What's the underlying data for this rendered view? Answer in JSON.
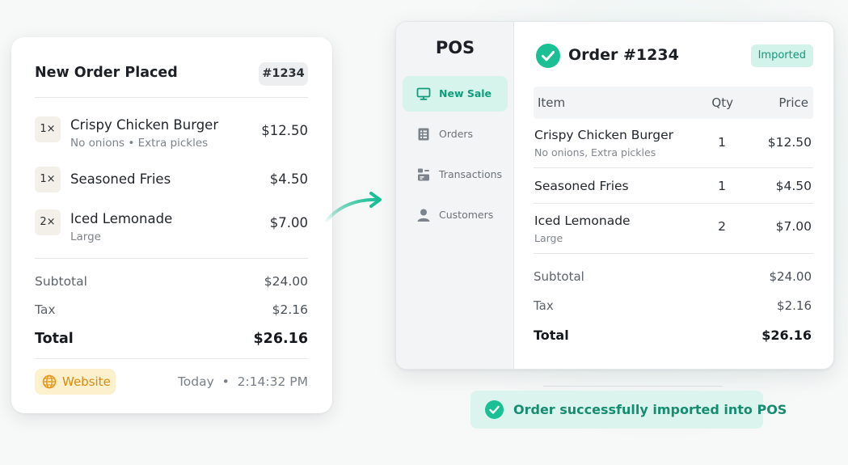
{
  "order_card": {
    "title": "New Order Placed",
    "order_badge": "#1234",
    "items": [
      {
        "qty": "1×",
        "name": "Crispy Chicken Burger",
        "modifiers": "No onions • Extra pickles",
        "price": "$12.50"
      },
      {
        "qty": "1×",
        "name": "Seasoned Fries",
        "modifiers": "",
        "price": "$4.50"
      },
      {
        "qty": "2×",
        "name": "Iced Lemonade",
        "modifiers": "Large",
        "price": "$7.00"
      }
    ],
    "subtotal_label": "Subtotal",
    "subtotal_value": "$24.00",
    "tax_label": "Tax",
    "tax_value": "$2.16",
    "total_label": "Total",
    "total_value": "$26.16",
    "source_label": "Website",
    "source_icon": "globe-icon",
    "timestamp": "Today  •  2:14:32 PM"
  },
  "pos": {
    "logo": "POS",
    "nav": [
      {
        "label": "New Sale",
        "icon": "monitor-icon",
        "active": true
      },
      {
        "label": "Orders",
        "icon": "receipt-icon",
        "active": false
      },
      {
        "label": "Transactions",
        "icon": "transactions-icon",
        "active": false
      },
      {
        "label": "Customers",
        "icon": "user-icon",
        "active": false
      }
    ],
    "title": "Order #1234",
    "status_badge": "Imported",
    "columns": {
      "item": "Item",
      "qty": "Qty",
      "price": "Price"
    },
    "rows": [
      {
        "name": "Crispy Chicken Burger",
        "modifiers": "No onions, Extra pickles",
        "qty": "1",
        "price": "$12.50"
      },
      {
        "name": "Seasoned Fries",
        "modifiers": "",
        "qty": "1",
        "price": "$4.50"
      },
      {
        "name": "Iced Lemonade",
        "modifiers": "Large",
        "qty": "2",
        "price": "$7.00"
      }
    ],
    "subtotal_label": "Subtotal",
    "subtotal_value": "$24.00",
    "tax_label": "Tax",
    "tax_value": "$2.16",
    "total_label": "Total",
    "total_value": "$26.16"
  },
  "toast": {
    "message": "Order successfully imported into POS",
    "icon": "check-circle-icon"
  },
  "colors": {
    "accent": "#1bbf94",
    "accent_text": "#168c71",
    "source_chip_bg": "#fdf0cc",
    "source_chip_text": "#d98a10"
  }
}
